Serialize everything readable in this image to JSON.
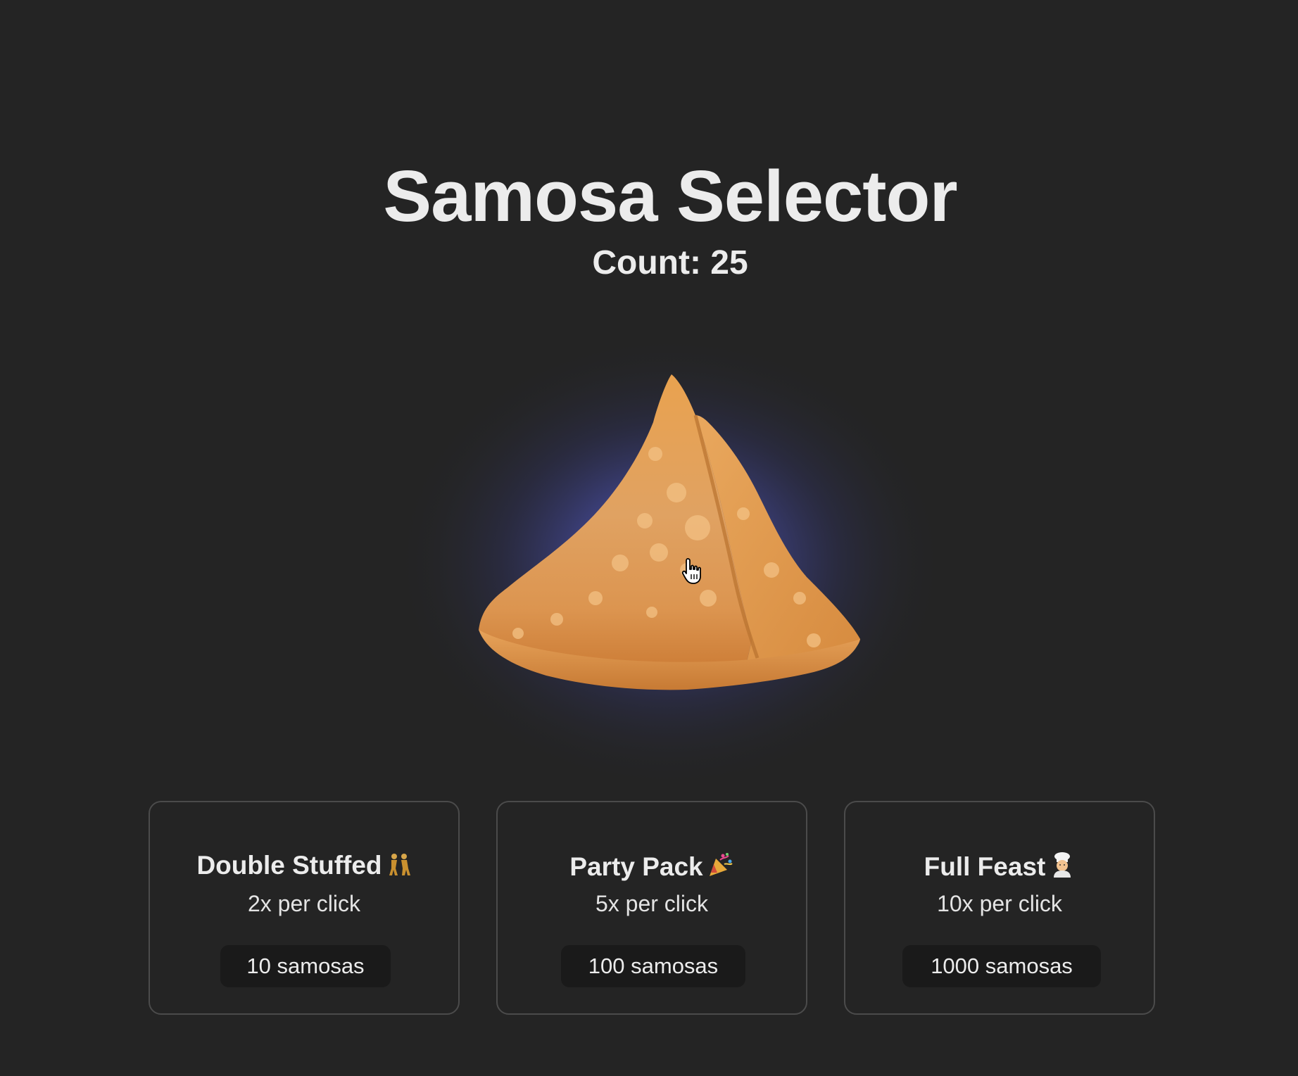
{
  "app": {
    "title": "Samosa Selector"
  },
  "counter": {
    "text": "Count: 25",
    "value": 25
  },
  "samosa": {
    "icon": "samosa-icon"
  },
  "upgrades": [
    {
      "name": "Double Stuffed",
      "emoji_icon": "dancers-emoji-icon",
      "rate": "2x per click",
      "price": "10 samosas"
    },
    {
      "name": "Party Pack",
      "emoji_icon": "party-popper-emoji-icon",
      "rate": "5x per click",
      "price": "100 samosas"
    },
    {
      "name": "Full Feast",
      "emoji_icon": "chef-emoji-icon",
      "rate": "10x per click",
      "price": "1000 samosas"
    }
  ],
  "colors": {
    "background": "#242424",
    "text": "#ececec",
    "glow": "#4b4fa0",
    "card_border": "#4b4b4b",
    "button_bg": "#1a1a1a"
  }
}
